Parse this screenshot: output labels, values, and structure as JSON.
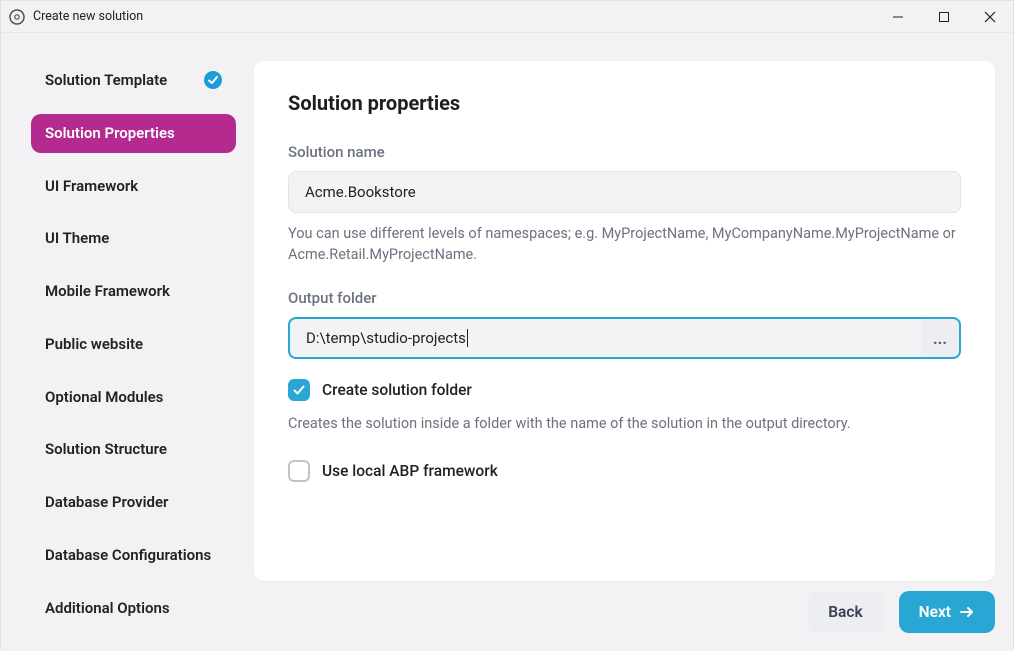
{
  "window": {
    "title": "Create new solution"
  },
  "sidebar": {
    "items": [
      {
        "label": "Solution Template",
        "completed": true,
        "active": false
      },
      {
        "label": "Solution Properties",
        "completed": false,
        "active": true
      },
      {
        "label": "UI Framework",
        "completed": false,
        "active": false
      },
      {
        "label": "UI Theme",
        "completed": false,
        "active": false
      },
      {
        "label": "Mobile Framework",
        "completed": false,
        "active": false
      },
      {
        "label": "Public website",
        "completed": false,
        "active": false
      },
      {
        "label": "Optional Modules",
        "completed": false,
        "active": false
      },
      {
        "label": "Solution Structure",
        "completed": false,
        "active": false
      },
      {
        "label": "Database Provider",
        "completed": false,
        "active": false
      },
      {
        "label": "Database Configurations",
        "completed": false,
        "active": false
      },
      {
        "label": "Additional Options",
        "completed": false,
        "active": false
      }
    ]
  },
  "main": {
    "heading": "Solution properties",
    "solution_name": {
      "label": "Solution name",
      "value": "Acme.Bookstore",
      "help": "You can use different levels of namespaces; e.g. MyProjectName, MyCompanyName.MyProjectName or Acme.Retail.MyProjectName."
    },
    "output_folder": {
      "label": "Output folder",
      "value": "D:\\temp\\studio-projects",
      "browse_label": "..."
    },
    "create_folder": {
      "label": "Create solution folder",
      "checked": true,
      "help": "Creates the solution inside a folder with the name of the solution in the output directory."
    },
    "use_local_abp": {
      "label": "Use local ABP framework",
      "checked": false
    }
  },
  "footer": {
    "back_label": "Back",
    "next_label": "Next"
  }
}
